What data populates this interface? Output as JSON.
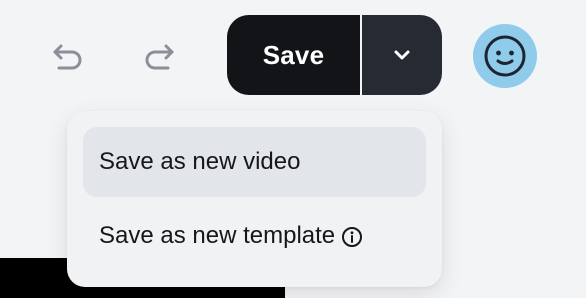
{
  "toolbar": {
    "undo_icon": "undo-icon",
    "redo_icon": "redo-icon",
    "save_label": "Save",
    "save_menu_icon": "chevron-down-icon",
    "avatar_icon": "smiley-face-icon"
  },
  "menu": {
    "items": [
      {
        "label": "Save as new video",
        "highlighted": true
      },
      {
        "label": "Save as new template",
        "icon": "info-icon"
      }
    ]
  },
  "colors": {
    "save_button_bg": "#121418",
    "save_caret_bg": "#252a33",
    "avatar_bg": "#8fcbea",
    "menu_bg": "#f1f2f4",
    "menu_highlight_bg": "#e2e5ea",
    "page_bg": "#f3f4f6"
  }
}
